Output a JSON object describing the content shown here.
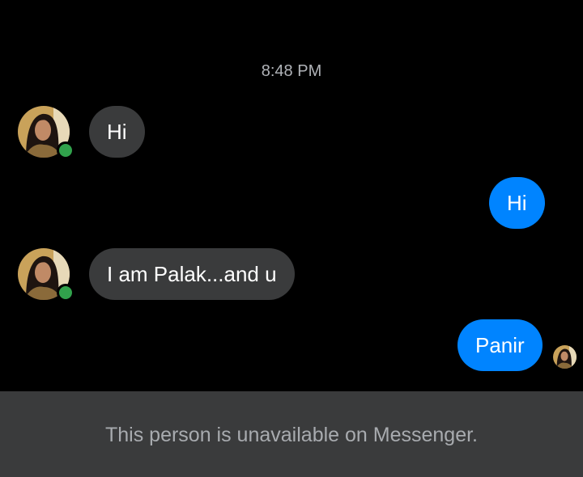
{
  "conversation": {
    "timestamp": "8:48 PM",
    "messages": [
      {
        "direction": "received",
        "text": "Hi"
      },
      {
        "direction": "sent",
        "text": "Hi"
      },
      {
        "direction": "received",
        "text": "I am Palak...and u"
      },
      {
        "direction": "sent",
        "text": "Panir"
      }
    ]
  },
  "contact": {
    "status": "online",
    "status_color": "#31a24c"
  },
  "footer": {
    "notice": "This person is unavailable on Messenger."
  },
  "colors": {
    "background": "#000000",
    "received_bubble": "#3a3b3c",
    "sent_bubble": "#0084ff",
    "footer_bar": "#3a3b3c"
  },
  "icons": [
    "contact-avatar-icon",
    "online-status-icon",
    "read-receipt-avatar-icon"
  ]
}
